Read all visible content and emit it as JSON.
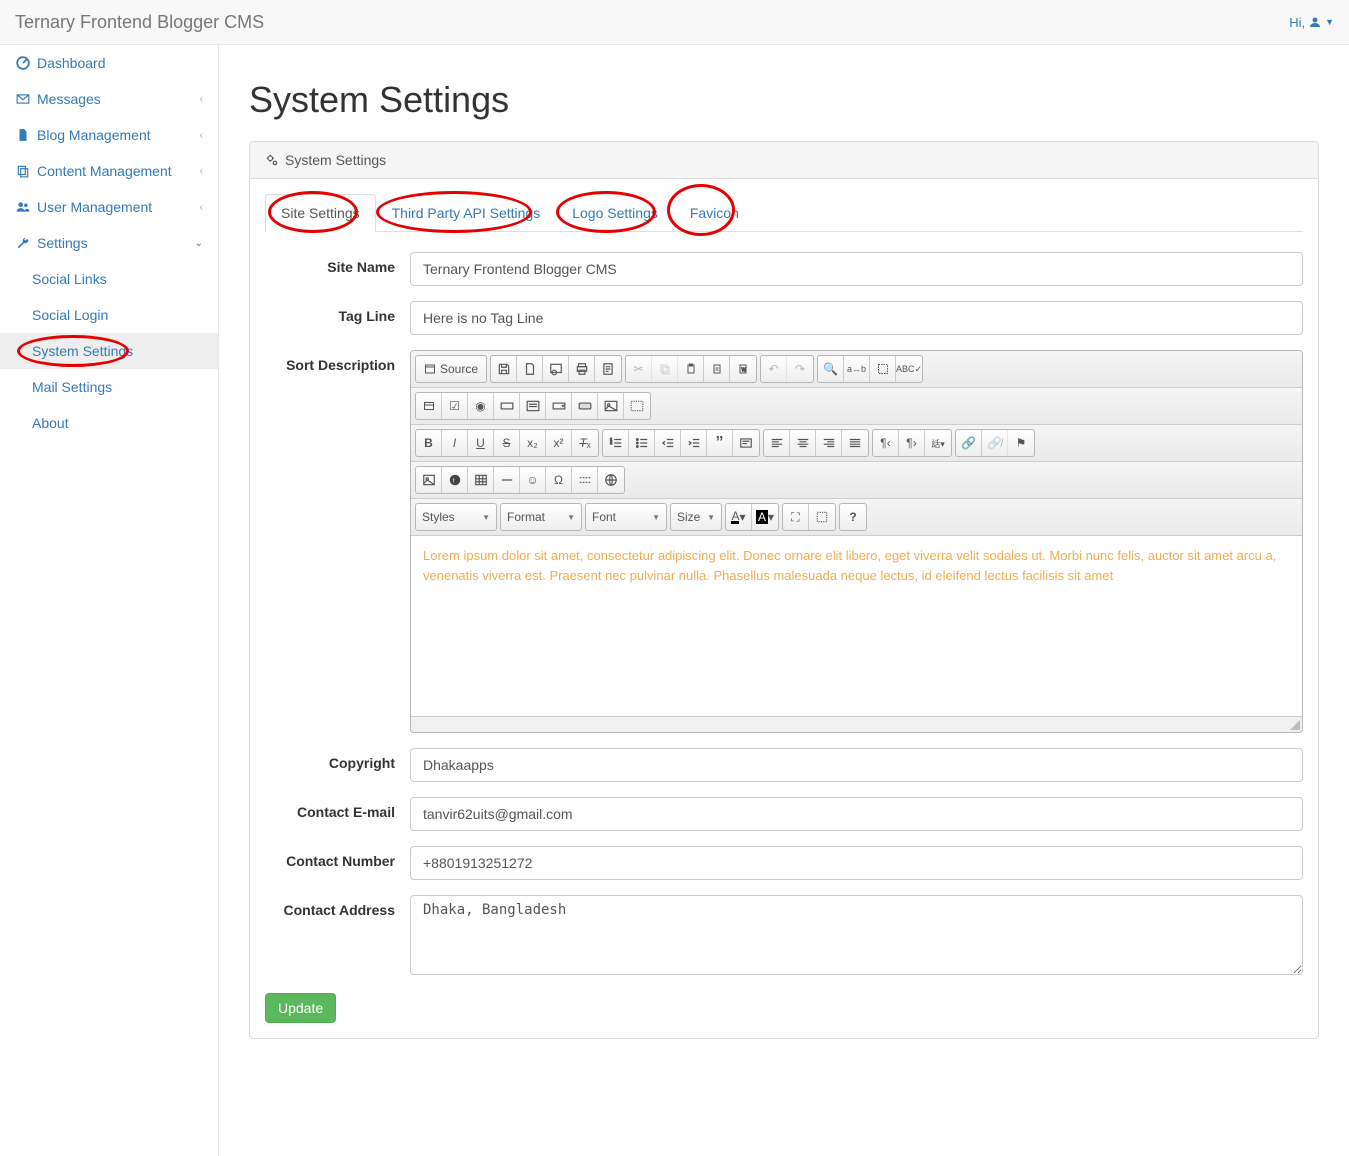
{
  "header": {
    "brand": "Ternary Frontend Blogger CMS",
    "greet": "Hi,"
  },
  "sidebar": {
    "items": [
      {
        "label": "Dashboard",
        "icon": "dashboard",
        "expand": false
      },
      {
        "label": "Messages",
        "icon": "envelope",
        "expand": true
      },
      {
        "label": "Blog Management",
        "icon": "file",
        "expand": true
      },
      {
        "label": "Content Management",
        "icon": "copy",
        "expand": true
      },
      {
        "label": "User Management",
        "icon": "users",
        "expand": true
      },
      {
        "label": "Settings",
        "icon": "wrench",
        "expand": true,
        "open": true
      }
    ],
    "settings_children": [
      "Social Links",
      "Social Login",
      "System Settings",
      "Mail Settings",
      "About"
    ],
    "active_child": "System Settings"
  },
  "page": {
    "title": "System Settings",
    "panel_title": "System Settings"
  },
  "tabs": [
    "Site Settings",
    "Third Party API Settings",
    "Logo Settings",
    "Favicon"
  ],
  "active_tab": "Site Settings",
  "editor": {
    "source_label": "Source",
    "dropdowns": {
      "styles": "Styles",
      "format": "Format",
      "font": "Font",
      "size": "Size"
    },
    "content": "Lorem ipsum dolor sit amet, consectetur adipiscing elit. Donec ornare elit libero, eget viverra velit sodales ut. Morbi nunc felis, auctor sit amet arcu a, venenatis viverra est. Praesent nec pulvinar nulla. Phasellus malesuada neque lectus, id eleifend lectus facilisis sit amet"
  },
  "form": {
    "labels": {
      "site_name": "Site Name",
      "tag_line": "Tag Line",
      "sort_description": "Sort Description",
      "copyright": "Copyright",
      "contact_email": "Contact E-mail",
      "contact_number": "Contact Number",
      "contact_address": "Contact Address"
    },
    "values": {
      "site_name": "Ternary Frontend Blogger CMS",
      "tag_line": "Here is no Tag Line",
      "copyright": "Dhakaapps",
      "contact_email": "tanvir62uits@gmail.com",
      "contact_number": "+8801913251272",
      "contact_address": "Dhaka, Bangladesh"
    },
    "submit": "Update"
  }
}
